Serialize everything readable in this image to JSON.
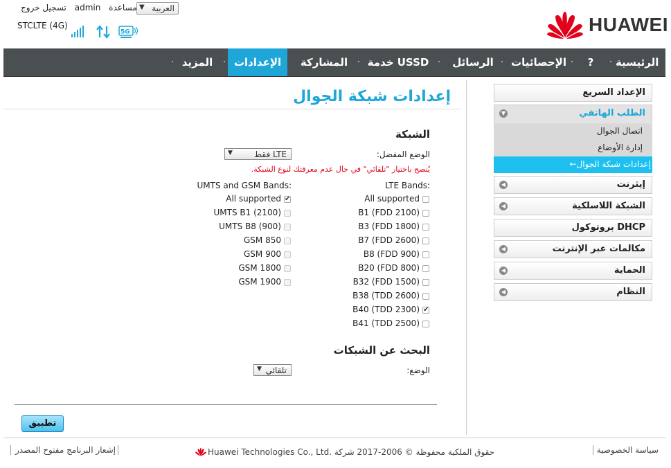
{
  "header": {
    "logout": "تسجيل خروج",
    "user": "admin",
    "help": "مساعدة",
    "language": "العربية",
    "carrier": "STCLTE (4G)",
    "brand": "HUAWEI"
  },
  "nav": {
    "home": "الرئيسية",
    "question": "?",
    "statistics": "الإحصائيات",
    "messages": "الرسائل",
    "ussd": "خدمة USSD",
    "sharing": "المشاركة",
    "settings": "الإعدادات",
    "more": "المزيد"
  },
  "sidebar": {
    "quick_setup": "الإعداد السريع",
    "dialup": "الطلب الهاتفي",
    "dialup_items": [
      "اتصال الجوال",
      "إدارة الأوضاع",
      "←إعدادات شبكة الجوال"
    ],
    "ethernet": "إيثرنت",
    "wlan": "الشبكة اللاسلكية",
    "dhcp": "بروتوكول DHCP",
    "voip": "مكالمات عبر الإنترنت",
    "security": "الحماية",
    "system": "النظام"
  },
  "main": {
    "title": "إعدادات شبكة الجوال",
    "network_heading": "الشبكة",
    "preferred_mode_label": "الوضع المفضل:",
    "preferred_mode_value": "LTE فقط",
    "warning": "يُنصح باختيار \"تلقائي\" في حال عدم معرفتك لنوع الشبكة.",
    "lte_bands_label": "LTE Bands:",
    "umts_gsm_label": "UMTS and GSM Bands:",
    "lte_bands": [
      {
        "label": "All supported",
        "checked": false
      },
      {
        "label": "B1 (FDD 2100)",
        "checked": false
      },
      {
        "label": "B3 (FDD 1800)",
        "checked": false
      },
      {
        "label": "B7 (FDD 2600)",
        "checked": false
      },
      {
        "label": "B8 (FDD 900)",
        "checked": false
      },
      {
        "label": "B20 (FDD 800)",
        "checked": false
      },
      {
        "label": "B32 (FDD 1500)",
        "checked": false
      },
      {
        "label": "B38 (TDD 2600)",
        "checked": false
      },
      {
        "label": "B40 (TDD 2300)",
        "checked": true
      },
      {
        "label": "B41 (TDD 2500)",
        "checked": false
      }
    ],
    "umts_gsm_bands": [
      {
        "label": "All supported",
        "checked": true
      },
      {
        "label": "UMTS B1 (2100)",
        "checked": false
      },
      {
        "label": "UMTS B8 (900)",
        "checked": false
      },
      {
        "label": "GSM 850",
        "checked": false
      },
      {
        "label": "GSM 900",
        "checked": false
      },
      {
        "label": "GSM 1800",
        "checked": false
      },
      {
        "label": "GSM 1900",
        "checked": false
      }
    ],
    "search_heading": "البحث عن الشبكات",
    "mode_label": "الوضع:",
    "mode_value": "تلقائي",
    "apply_button": "تطبيق"
  },
  "footer": {
    "privacy": "سياسة الخصوصية",
    "copyright": "Huawei Technologies Co., Ltd. حقوق الملكية محفوظة © 2006-2017 شركة",
    "opensource": "إشعار البرنامج مفتوح المصدر"
  },
  "colors": {
    "accent": "#1ea6d9",
    "nav_bg": "#4a4f52",
    "warning": "#e2001a",
    "logo_red": "#e2001a"
  }
}
